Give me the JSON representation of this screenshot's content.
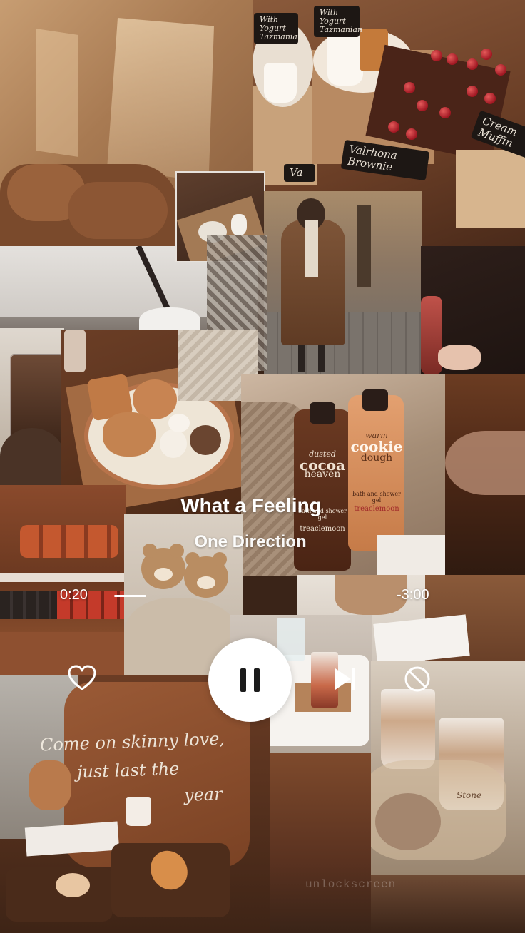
{
  "player": {
    "song_title": "What a Feeling",
    "artist": "One Direction",
    "elapsed": "0:20",
    "total": "-3:00",
    "progress_fraction": 0.11
  },
  "controls": {
    "like_icon": "heart-icon",
    "pause_icon": "pause-icon",
    "next_icon": "skip-next-icon",
    "block_icon": "block-icon"
  },
  "signs": {
    "yogurt_1": "With Yogurt Tazmanian",
    "yogurt_2": "With Yogurt Tazmanian",
    "brownie": "Valrhona Brownie",
    "muffin": "Cream Muffin",
    "va": "Va"
  },
  "products": {
    "bottle1_line1": "dusted",
    "bottle1_line2": "cocoa",
    "bottle1_line3": "heaven",
    "bottle1_sub": "bath and shower gel",
    "bottle1_brand": "treaclemoon",
    "bottle2_line1": "warm",
    "bottle2_line2": "cookie",
    "bottle2_line3": "dough",
    "bottle2_sub": "bath and shower gel",
    "bottle2_brand": "treaclemoon"
  },
  "handwriting": {
    "line1": "Come on skinny love,",
    "line2": "just last the",
    "line3": "year"
  },
  "watermark": "unlockscreen",
  "cup_logo": "Stone",
  "colors": {
    "accent": "#ffffff",
    "background": "#3a2418"
  }
}
